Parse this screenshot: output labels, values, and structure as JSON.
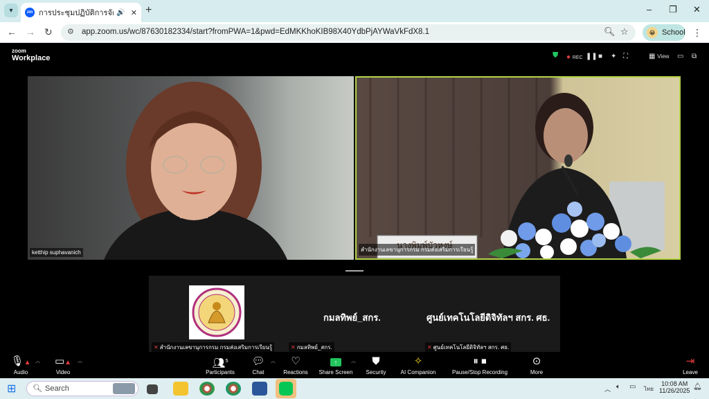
{
  "browser": {
    "tab": {
      "title": "การประชุมปฏิบัติการจัดทำแผนฯ",
      "favicon": "zm"
    },
    "new_tab": "+",
    "window_controls": {
      "minimize": "–",
      "maximize": "❐",
      "close": "✕"
    },
    "url": "app.zoom.us/wc/87630182334/start?fromPWA=1&pwd=EdMKKhoKIB98X40YdbPjAYWaVkFdX8.1",
    "profile_label": "School"
  },
  "zoom": {
    "logo_top": "zoom",
    "logo_bottom": "Workplace",
    "rec_label": "REC",
    "view_label": "View",
    "participants_count": "5"
  },
  "videos": [
    {
      "name": "ketthip suphavanich"
    },
    {
      "name": "สำนักงานเลขานุการกรม กรมส่งเสริมการเรียนรู้",
      "sign": "นางพิมพ์บัวหงษ์"
    }
  ],
  "gallery": [
    {
      "display": "",
      "tag": "สำนักงานเลขานุการกรม กรมส่งเสริมการเรียนรู้"
    },
    {
      "display": "กมลทิพย์_สกร.",
      "tag": "กมลทิพย์_สกร."
    },
    {
      "display": "ศูนย์เทคโนโลยีดิจิทัลฯ สกร. ศธ.",
      "tag": "ศูนย์เทคโนโลยีดิจิทัลฯ สกร. ศธ."
    }
  ],
  "toolbar": {
    "audio": "Audio",
    "video": "Video",
    "participants": "Participants",
    "chat": "Chat",
    "reactions": "Reactions",
    "share": "Share Screen",
    "security": "Security",
    "ai": "AI Companion",
    "record": "Pause/Stop Recording",
    "more": "More",
    "leave": "Leave"
  },
  "taskbar": {
    "search_placeholder": "Search",
    "time": "10:08 AM",
    "date": "11/26/2025",
    "lang": "ไทย"
  },
  "colors": {
    "active_speaker": "#b5d44a",
    "zoom_blue": "#0b5cff",
    "share_green": "#22c55e",
    "leave_red": "#e23b3b"
  }
}
